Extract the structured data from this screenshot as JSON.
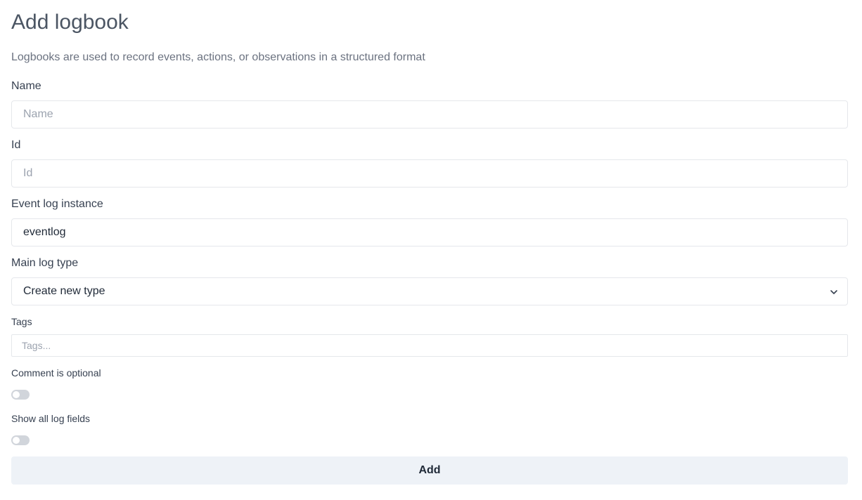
{
  "page": {
    "title": "Add logbook",
    "subtitle": "Logbooks are used to record events, actions, or observations in a structured format"
  },
  "form": {
    "name": {
      "label": "Name",
      "value": "",
      "placeholder": "Name"
    },
    "id": {
      "label": "Id",
      "value": "",
      "placeholder": "Id"
    },
    "event_log_instance": {
      "label": "Event log instance",
      "value": "eventlog",
      "placeholder": ""
    },
    "main_log_type": {
      "label": "Main log type",
      "selected": "Create new type",
      "icon": "chevron-down-icon"
    },
    "tags": {
      "label": "Tags",
      "value": "",
      "placeholder": "Tags..."
    },
    "comment_optional": {
      "label": "Comment is optional",
      "checked": false
    },
    "show_all_fields": {
      "label": "Show all log fields",
      "checked": false
    },
    "submit_label": "Add"
  },
  "colors": {
    "title": "#4b5563",
    "border": "#e5e7eb",
    "toggle_off": "#d1d5db",
    "button_bg": "#eef2f7"
  }
}
